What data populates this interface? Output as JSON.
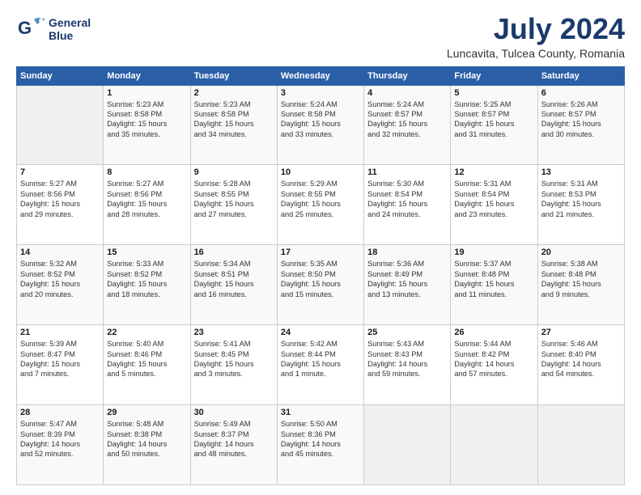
{
  "logo": {
    "line1": "General",
    "line2": "Blue"
  },
  "title": "July 2024",
  "location": "Luncavita, Tulcea County, Romania",
  "weekdays": [
    "Sunday",
    "Monday",
    "Tuesday",
    "Wednesday",
    "Thursday",
    "Friday",
    "Saturday"
  ],
  "weeks": [
    [
      {
        "day": "",
        "detail": ""
      },
      {
        "day": "1",
        "detail": "Sunrise: 5:23 AM\nSunset: 8:58 PM\nDaylight: 15 hours\nand 35 minutes."
      },
      {
        "day": "2",
        "detail": "Sunrise: 5:23 AM\nSunset: 8:58 PM\nDaylight: 15 hours\nand 34 minutes."
      },
      {
        "day": "3",
        "detail": "Sunrise: 5:24 AM\nSunset: 8:58 PM\nDaylight: 15 hours\nand 33 minutes."
      },
      {
        "day": "4",
        "detail": "Sunrise: 5:24 AM\nSunset: 8:57 PM\nDaylight: 15 hours\nand 32 minutes."
      },
      {
        "day": "5",
        "detail": "Sunrise: 5:25 AM\nSunset: 8:57 PM\nDaylight: 15 hours\nand 31 minutes."
      },
      {
        "day": "6",
        "detail": "Sunrise: 5:26 AM\nSunset: 8:57 PM\nDaylight: 15 hours\nand 30 minutes."
      }
    ],
    [
      {
        "day": "7",
        "detail": "Sunrise: 5:27 AM\nSunset: 8:56 PM\nDaylight: 15 hours\nand 29 minutes."
      },
      {
        "day": "8",
        "detail": "Sunrise: 5:27 AM\nSunset: 8:56 PM\nDaylight: 15 hours\nand 28 minutes."
      },
      {
        "day": "9",
        "detail": "Sunrise: 5:28 AM\nSunset: 8:55 PM\nDaylight: 15 hours\nand 27 minutes."
      },
      {
        "day": "10",
        "detail": "Sunrise: 5:29 AM\nSunset: 8:55 PM\nDaylight: 15 hours\nand 25 minutes."
      },
      {
        "day": "11",
        "detail": "Sunrise: 5:30 AM\nSunset: 8:54 PM\nDaylight: 15 hours\nand 24 minutes."
      },
      {
        "day": "12",
        "detail": "Sunrise: 5:31 AM\nSunset: 8:54 PM\nDaylight: 15 hours\nand 23 minutes."
      },
      {
        "day": "13",
        "detail": "Sunrise: 5:31 AM\nSunset: 8:53 PM\nDaylight: 15 hours\nand 21 minutes."
      }
    ],
    [
      {
        "day": "14",
        "detail": "Sunrise: 5:32 AM\nSunset: 8:52 PM\nDaylight: 15 hours\nand 20 minutes."
      },
      {
        "day": "15",
        "detail": "Sunrise: 5:33 AM\nSunset: 8:52 PM\nDaylight: 15 hours\nand 18 minutes."
      },
      {
        "day": "16",
        "detail": "Sunrise: 5:34 AM\nSunset: 8:51 PM\nDaylight: 15 hours\nand 16 minutes."
      },
      {
        "day": "17",
        "detail": "Sunrise: 5:35 AM\nSunset: 8:50 PM\nDaylight: 15 hours\nand 15 minutes."
      },
      {
        "day": "18",
        "detail": "Sunrise: 5:36 AM\nSunset: 8:49 PM\nDaylight: 15 hours\nand 13 minutes."
      },
      {
        "day": "19",
        "detail": "Sunrise: 5:37 AM\nSunset: 8:48 PM\nDaylight: 15 hours\nand 11 minutes."
      },
      {
        "day": "20",
        "detail": "Sunrise: 5:38 AM\nSunset: 8:48 PM\nDaylight: 15 hours\nand 9 minutes."
      }
    ],
    [
      {
        "day": "21",
        "detail": "Sunrise: 5:39 AM\nSunset: 8:47 PM\nDaylight: 15 hours\nand 7 minutes."
      },
      {
        "day": "22",
        "detail": "Sunrise: 5:40 AM\nSunset: 8:46 PM\nDaylight: 15 hours\nand 5 minutes."
      },
      {
        "day": "23",
        "detail": "Sunrise: 5:41 AM\nSunset: 8:45 PM\nDaylight: 15 hours\nand 3 minutes."
      },
      {
        "day": "24",
        "detail": "Sunrise: 5:42 AM\nSunset: 8:44 PM\nDaylight: 15 hours\nand 1 minute."
      },
      {
        "day": "25",
        "detail": "Sunrise: 5:43 AM\nSunset: 8:43 PM\nDaylight: 14 hours\nand 59 minutes."
      },
      {
        "day": "26",
        "detail": "Sunrise: 5:44 AM\nSunset: 8:42 PM\nDaylight: 14 hours\nand 57 minutes."
      },
      {
        "day": "27",
        "detail": "Sunrise: 5:46 AM\nSunset: 8:40 PM\nDaylight: 14 hours\nand 54 minutes."
      }
    ],
    [
      {
        "day": "28",
        "detail": "Sunrise: 5:47 AM\nSunset: 8:39 PM\nDaylight: 14 hours\nand 52 minutes."
      },
      {
        "day": "29",
        "detail": "Sunrise: 5:48 AM\nSunset: 8:38 PM\nDaylight: 14 hours\nand 50 minutes."
      },
      {
        "day": "30",
        "detail": "Sunrise: 5:49 AM\nSunset: 8:37 PM\nDaylight: 14 hours\nand 48 minutes."
      },
      {
        "day": "31",
        "detail": "Sunrise: 5:50 AM\nSunset: 8:36 PM\nDaylight: 14 hours\nand 45 minutes."
      },
      {
        "day": "",
        "detail": ""
      },
      {
        "day": "",
        "detail": ""
      },
      {
        "day": "",
        "detail": ""
      }
    ]
  ]
}
